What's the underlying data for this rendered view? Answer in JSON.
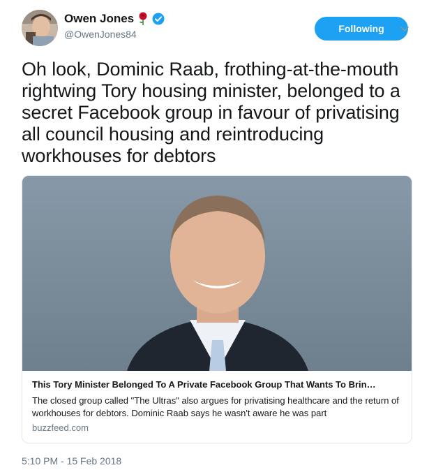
{
  "author": {
    "display_name": "Owen Jones",
    "handle": "@OwenJones84",
    "badge_emoji_icon": "rose-icon",
    "verified_icon": "verified-icon",
    "follow_label": "Following"
  },
  "tweet": {
    "text": "Oh look, Dominic Raab, frothing-at-the-mouth rightwing Tory housing minister, belonged to a secret Facebook group in favour of privatising all council housing and reintroducing workhouses for debtors",
    "timestamp": "5:10 PM - 15 Feb 2018"
  },
  "card": {
    "title": "This Tory Minister Belonged To A Private Facebook Group That Wants To Brin…",
    "description": "The closed group called \"The Ultras\" also argues for privatising healthcare and the return of workhouses for debtors. Dominic Raab says he wasn't aware he was part",
    "domain": "buzzfeed.com"
  },
  "colors": {
    "accent": "#1da1f2",
    "secondary_text": "#657786",
    "border": "#e1e8ed"
  }
}
